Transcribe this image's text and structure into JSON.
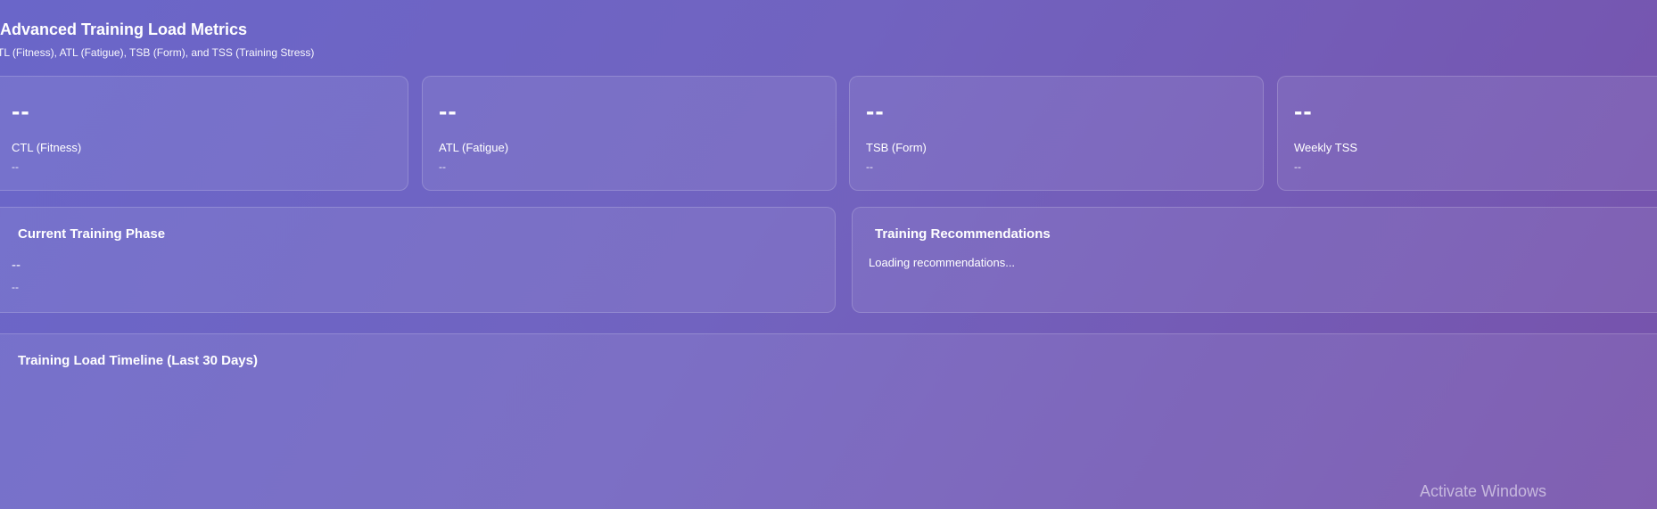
{
  "header": {
    "title": "Advanced Training Load Metrics",
    "subtitle": "TL (Fitness), ATL (Fatigue), TSB (Form), and TSS (Training Stress)"
  },
  "metrics": [
    {
      "value": "--",
      "label": "CTL (Fitness)",
      "sub": "--"
    },
    {
      "value": "--",
      "label": "ATL (Fatigue)",
      "sub": "--"
    },
    {
      "value": "--",
      "label": "TSB (Form)",
      "sub": "--"
    },
    {
      "value": "--",
      "label": "Weekly TSS",
      "sub": "--"
    }
  ],
  "phase": {
    "title": "Current Training Phase",
    "value": "--",
    "sub": "--"
  },
  "recommendations": {
    "title": "Training Recommendations",
    "text": "Loading recommendations..."
  },
  "timeline": {
    "title": "Training Load Timeline (Last 30 Days)"
  },
  "watermark": {
    "text": "Activate Windows"
  }
}
